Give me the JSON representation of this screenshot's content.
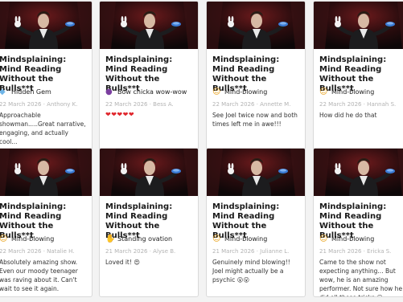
{
  "show_title": "Mindsplaining: Mind Reading Without the Bulls**t",
  "cards": [
    {
      "title_lines": [
        "Mindsplaining:",
        "Mind Reading",
        "Without the Bulls**t"
      ],
      "badge_icon": "diamond-icon",
      "badge": "Hidden Gem",
      "meta": "22 March 2026 · Anthony K.",
      "review": "Approachable showman.....Great narrative, engaging, and actually cool..."
    },
    {
      "title_lines": [
        "Mindsplaining:",
        "Mind Reading",
        "Without the Bulls**t"
      ],
      "badge_icon": "eggplant-icon",
      "badge": "Bow chicka wow-wow",
      "meta": "22 March 2026 · Bess A.",
      "review": "",
      "hearts": "❤❤❤❤❤"
    },
    {
      "title_lines": [
        "Mindsplaining:",
        "Mind Reading",
        "Without the Bulls**t"
      ],
      "badge_icon": "mind-blown-face-icon",
      "badge": "Mind-blowing",
      "meta": "22 March 2026 · Annette M.",
      "review": "See Joel twice now and both times left me in awe!!!"
    },
    {
      "title_lines": [
        "Mindsplaining:",
        "Mind Reading",
        "Without the Bulls**t"
      ],
      "badge_icon": "mind-blown-face-icon",
      "badge": "Mind-blowing",
      "meta": "22 March 2026 · Hannah S.",
      "review": "How did he do that"
    },
    {
      "title_lines": [
        "Mindsplaining:",
        "Mind Reading",
        "Without the Bulls**t"
      ],
      "badge_icon": "mind-blown-face-icon",
      "badge": "Mind-blowing",
      "meta": "22 March 2026 · Natalie H.",
      "review": "Absolutely amazing show. Even our moody teenager was raving about it. Can't wait to see it again."
    },
    {
      "title_lines": [
        "Mindsplaining:",
        "Mind Reading",
        "Without the Bulls**t"
      ],
      "badge_icon": "clapping-hands-icon",
      "badge": "Standing ovation",
      "meta": "21 March 2026 · Alyse B.",
      "review": "Loved it! 😍"
    },
    {
      "title_lines": [
        "Mindsplaining:",
        "Mind Reading",
        "Without the Bulls**t"
      ],
      "badge_icon": "mind-blown-face-icon",
      "badge": "Mind-blowing",
      "meta": "21 March 2026 · Julianne L.",
      "review": "Genuinely mind blowing!! Joel might actually be a psychic 😮😮"
    },
    {
      "title_lines": [
        "Mindsplaining:",
        "Mind Reading",
        "Without the Bulls**t"
      ],
      "badge_icon": "mind-blown-face-icon",
      "badge": "Mind-blowing",
      "meta": "21 March 2026 · Ericka S.",
      "review": "Came to the show not expecting anything... But wow, he is an amazing performer. Not sure how he did all those tricks 😮"
    }
  ]
}
